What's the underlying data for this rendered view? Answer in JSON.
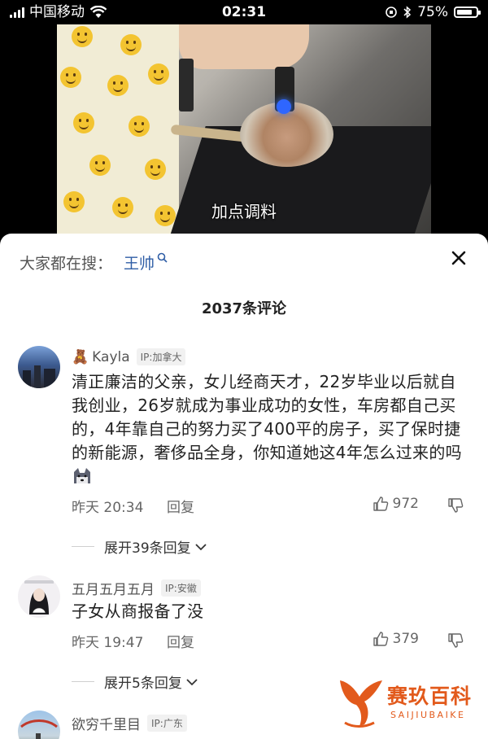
{
  "status_bar": {
    "carrier": "中国移动",
    "time": "02:31",
    "battery": "75%"
  },
  "video": {
    "caption": "加点调料"
  },
  "comments_panel": {
    "search_prefix": "大家都在搜：",
    "search_term": "王帅",
    "count_label": "2037条评论",
    "comments": [
      {
        "user": "Kayla",
        "ip": "IP:加拿大",
        "text": "清正廉洁的父亲，女儿经商天才，22岁毕业以后就自我创业，26岁就成为事业成功的女性，车房都自己买的，4年靠自己的努力买了400平的房子，买了保时捷的新能源，奢侈品全身，你知道她这4年怎么过来的吗",
        "time": "昨天 20:34",
        "reply_label": "回复",
        "likes": "972",
        "expand_label": "展开39条回复"
      },
      {
        "user": "五月五月五月",
        "ip": "IP:安徽",
        "text": "子女从商报备了没",
        "time": "昨天 19:47",
        "reply_label": "回复",
        "likes": "379",
        "expand_label": "展开5条回复"
      },
      {
        "user": "欲穷千里目",
        "ip": "IP:广东"
      }
    ]
  },
  "watermark": {
    "name_cn": "赛玖百科",
    "name_en": "SAIJIUBAIKE",
    "brand_color": "#e25a1c"
  },
  "icons": [
    "signal-icon",
    "wifi-icon",
    "battery-icon",
    "search-icon",
    "close-icon",
    "thumbs-up-icon",
    "thumbs-down-icon",
    "chevron-down-icon"
  ]
}
